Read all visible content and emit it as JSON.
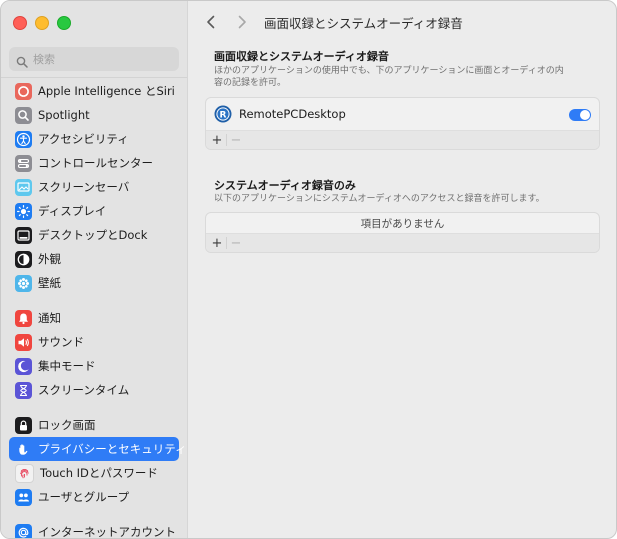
{
  "sidebar": {
    "search_placeholder": "検索",
    "groups": [
      [
        {
          "label": "Apple Intelligence とSiri",
          "icon": "apple-intelligence-icon",
          "color": "#e9675c"
        },
        {
          "label": "Spotlight",
          "icon": "spotlight-icon",
          "color": "#8d8d93"
        },
        {
          "label": "アクセシビリティ",
          "icon": "accessibility-icon",
          "color": "#1e7cf2"
        },
        {
          "label": "コントロールセンター",
          "icon": "control-center-icon",
          "color": "#8d8d93"
        },
        {
          "label": "スクリーンセーバ",
          "icon": "screen-saver-icon",
          "color": "#5ec8ee"
        },
        {
          "label": "ディスプレイ",
          "icon": "display-icon",
          "color": "#1e7cf2"
        },
        {
          "label": "デスクトップとDock",
          "icon": "desktop-dock-icon",
          "color": "#1c1c1e"
        },
        {
          "label": "外観",
          "icon": "appearance-icon",
          "color": "#1c1c1e"
        },
        {
          "label": "壁紙",
          "icon": "wallpaper-icon",
          "color": "#4fb6ea"
        }
      ],
      [
        {
          "label": "通知",
          "icon": "notifications-icon",
          "color": "#f0463f"
        },
        {
          "label": "サウンド",
          "icon": "sound-icon",
          "color": "#f0463f"
        },
        {
          "label": "集中モード",
          "icon": "focus-icon",
          "color": "#5b54d6"
        },
        {
          "label": "スクリーンタイム",
          "icon": "screen-time-icon",
          "color": "#5b54d6"
        }
      ],
      [
        {
          "label": "ロック画面",
          "icon": "lock-screen-icon",
          "color": "#1c1c1e"
        },
        {
          "label": "プライバシーとセキュリティ",
          "icon": "privacy-hand-icon",
          "color": "#2f7cf6",
          "selected": true
        },
        {
          "label": "Touch IDとパスワード",
          "icon": "touch-id-icon",
          "color": "#f2f2f2"
        },
        {
          "label": "ユーザとグループ",
          "icon": "users-groups-icon",
          "color": "#1e7cf2"
        }
      ],
      [
        {
          "label": "インターネットアカウント",
          "icon": "internet-accounts-icon",
          "color": "#1e7cf2"
        }
      ]
    ]
  },
  "toolbar": {
    "title": "画面収録とシステムオーディオ録音"
  },
  "section1": {
    "title": "画面収録とシステムオーディオ録音",
    "description": "ほかのアプリケーションの使用中でも、下のアプリケーションに画面とオーディオの内容の記録を許可。",
    "apps": [
      {
        "name": "RemotePCDesktop",
        "enabled": true
      }
    ],
    "add_label": "+",
    "remove_label": "−"
  },
  "section2": {
    "title": "システムオーディオ録音のみ",
    "description": "以下のアプリケーションにシステムオーディオへのアクセスと録音を許可します。",
    "empty_text": "項目がありません",
    "add_label": "+",
    "remove_label": "−"
  },
  "colors": {
    "accent": "#2f7cf6",
    "window_bg": "#ececec",
    "sidebar_bg": "#e3e3e3"
  }
}
